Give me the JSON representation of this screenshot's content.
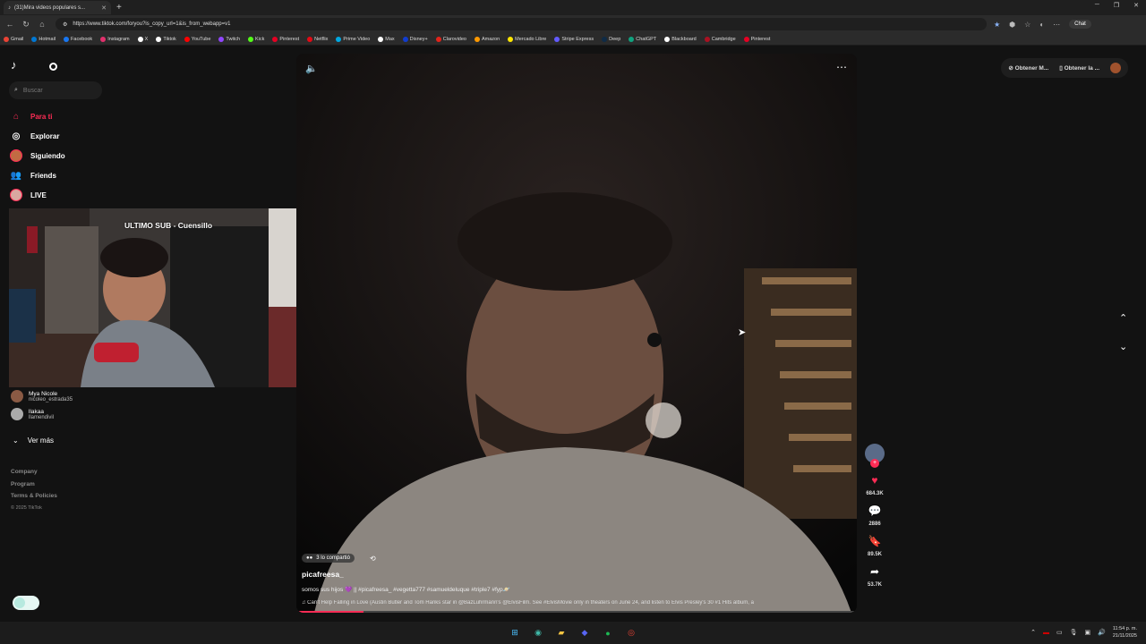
{
  "browser": {
    "tab_title": "(31)Mira videos populares s...",
    "url": "https://www.tiktok.com/foryou?is_copy_url=1&is_from_webapp=v1",
    "chat_label": "Chat",
    "bookmarks": [
      {
        "label": "Gmail",
        "color": "#ea4335"
      },
      {
        "label": "Hotmail",
        "color": "#0078d4"
      },
      {
        "label": "Facebook",
        "color": "#1877f2"
      },
      {
        "label": "Instagram",
        "color": "#e1306c"
      },
      {
        "label": "X",
        "color": "#ffffff"
      },
      {
        "label": "Tiktok",
        "color": "#ffffff"
      },
      {
        "label": "YouTube",
        "color": "#ff0000"
      },
      {
        "label": "Twitch",
        "color": "#9146ff"
      },
      {
        "label": "Kick",
        "color": "#53fc18"
      },
      {
        "label": "Pinterest",
        "color": "#e60023"
      },
      {
        "label": "Netflix",
        "color": "#e50914"
      },
      {
        "label": "Prime Video",
        "color": "#00a8e1"
      },
      {
        "label": "Max",
        "color": "#ffffff"
      },
      {
        "label": "Disney+",
        "color": "#113ccf"
      },
      {
        "label": "Clarovideo",
        "color": "#e2231a"
      },
      {
        "label": "Amazon",
        "color": "#ff9900"
      },
      {
        "label": "Mercado Libre",
        "color": "#ffe600"
      },
      {
        "label": "Stripe Express",
        "color": "#635bff"
      },
      {
        "label": "Deep",
        "color": "#0f2b46"
      },
      {
        "label": "ChatGPT",
        "color": "#10a37f"
      },
      {
        "label": "Blackboard",
        "color": "#ffffff"
      },
      {
        "label": "Cambridge",
        "color": "#a12"
      },
      {
        "label": "Pinterest",
        "color": "#e60023"
      }
    ]
  },
  "sidebar": {
    "search_placeholder": "Buscar",
    "nav": [
      {
        "label": "Para ti",
        "icon": "home-icon",
        "active": true
      },
      {
        "label": "Explorar",
        "icon": "compass-icon"
      },
      {
        "label": "Siguiendo",
        "icon": "following-avatar-icon"
      },
      {
        "label": "Friends",
        "icon": "friends-icon"
      },
      {
        "label": "LIVE",
        "icon": "live-icon"
      }
    ],
    "overlay_title": "ULTIMO SUB - Cuensillo",
    "following": [
      {
        "name": "Mya Nicole",
        "handle": "nicoleo_estrada35",
        "color": "#8a5a44"
      },
      {
        "name": "llakaa",
        "handle": "llamendivil",
        "color": "#aaa"
      }
    ],
    "ver_mas": "Ver más",
    "footer": [
      "Company",
      "Program",
      "Terms & Policies"
    ],
    "copyright": "© 2025 TikTok"
  },
  "video": {
    "shared_label": "3 lo compartió",
    "author": "picafreesa_",
    "description": "somos sus hijos 💜 || #picafreesa_ #vegetta777 #samueldeluque #triple7 #fyp🪐",
    "music": "Can't Help Falling in Love (Austin Butler and Tom Hanks star in @BazLuhrmann's @ElvisFilm. See #ElvisMovie only in theaters on June 24, and listen to Elvis Presley's 30 #1 Hits album, a",
    "progress": 0.12
  },
  "actions": {
    "likes": "684.3K",
    "comments": "2886",
    "saves": "89.5K",
    "shares": "53.7K"
  },
  "topright": {
    "btn1": "Obtener M...",
    "btn2": "Obtener la ..."
  },
  "taskbar": {
    "time": "11:54 p. m.",
    "date": "21/11/2025"
  }
}
